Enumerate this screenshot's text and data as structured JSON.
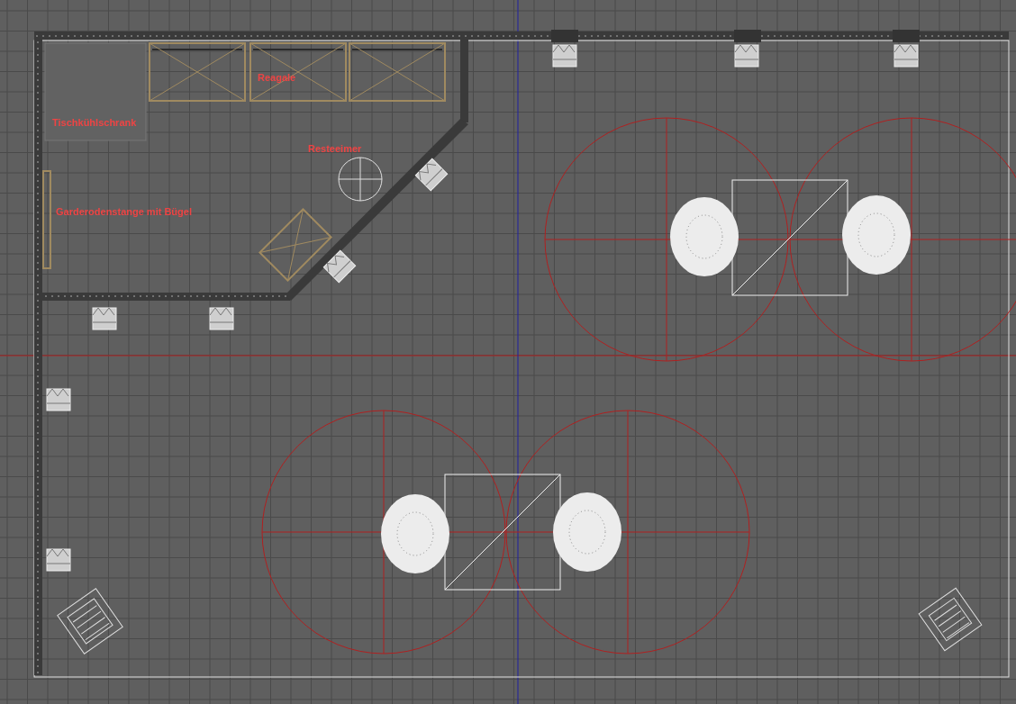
{
  "viewport": {
    "labels": [
      {
        "kind": "shelf",
        "text": "Reagale"
      },
      {
        "kind": "fridge",
        "text": "Tischkühlschrank"
      },
      {
        "kind": "bin",
        "text": "Resteeimer"
      },
      {
        "kind": "rack",
        "text": "Garderodenstange mit Bügel"
      }
    ]
  }
}
